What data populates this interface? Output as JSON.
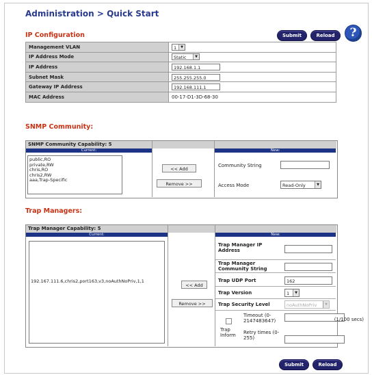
{
  "breadcrumb": "Administration > Quick Start",
  "ip_config": {
    "title": "IP Configuration",
    "submit_label": "Submit",
    "reload_label": "Reload",
    "help_icon": "help-icon",
    "rows": [
      {
        "label": "Management VLAN",
        "value": "1",
        "kind": "select"
      },
      {
        "label": "IP Address Mode",
        "value": "Static",
        "kind": "select"
      },
      {
        "label": "IP Address",
        "value": "192.168.1.1",
        "kind": "input"
      },
      {
        "label": "Subnet Mask",
        "value": "255.255.255.0",
        "kind": "input"
      },
      {
        "label": "Gateway IP Address",
        "value": "192.168.111.1",
        "kind": "input"
      },
      {
        "label": "MAC Address",
        "value": "00-17-D1-3D-68-30",
        "kind": "text"
      }
    ]
  },
  "snmp": {
    "title": "SNMP Community:",
    "capability": "SNMP Community Capability: 5",
    "current_header": "Current:",
    "new_header": "New:",
    "communities": [
      "public,RO",
      "private,RW",
      "chris,RO",
      "chris2,RW",
      "aaa,Trap-Specific"
    ],
    "add_label": "<< Add",
    "remove_label": "Remove >>",
    "community_string_label": "Community String",
    "community_string_value": "",
    "access_mode_label": "Access Mode",
    "access_mode_value": "Read-Only"
  },
  "trap": {
    "title": "Trap Managers:",
    "capability": "Trap Manager Capability: 5",
    "current_header": "Current:",
    "new_header": "New:",
    "managers": [
      "192.167.111.6,chris2,port163,v3,noAuthNoPriv,1,1"
    ],
    "add_label": "<< Add",
    "remove_label": "Remove >>",
    "ip_label": "Trap Manager IP Address",
    "ip_value": "",
    "community_label": "Trap Manager Community String",
    "community_value": "",
    "udp_label": "Trap UDP Port",
    "udp_value": "162",
    "version_label": "Trap Version",
    "version_value": "1",
    "security_label": "Trap Security Level",
    "security_value": "noAuthNoPriv",
    "inform_label": "Trap Inform",
    "timeout_label": "Timeout (0-2147483647)",
    "timeout_value": "",
    "timeout_unit": "(1/100 secs)",
    "retry_label": "Retry times (0-255)",
    "retry_value": ""
  },
  "footer": {
    "submit_label": "Submit",
    "reload_label": "Reload"
  },
  "colors": {
    "title_blue": "#2a3a8c",
    "section_red": "#c83214",
    "header_navy": "#1d3386",
    "button_navy": "#23236b"
  }
}
